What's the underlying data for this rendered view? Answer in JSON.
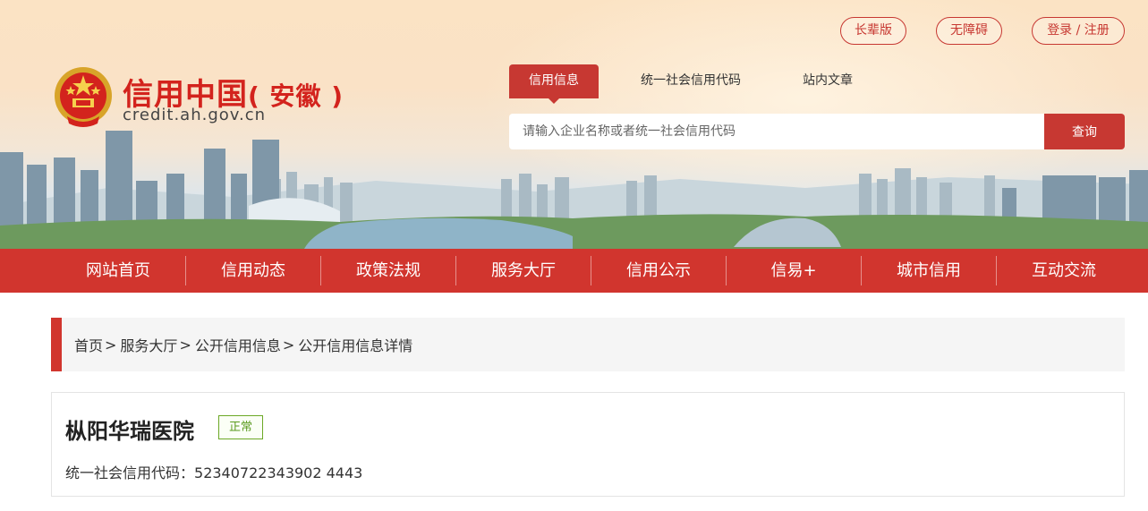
{
  "top_links": {
    "elder": "长辈版",
    "accessible": "无障碍",
    "login": "登录 / 注册"
  },
  "brand": {
    "title_main": "信用中国",
    "title_region": "( 安徽 )",
    "domain": "credit.ah.gov.cn"
  },
  "search": {
    "tabs": [
      "信用信息",
      "统一社会信用代码",
      "站内文章"
    ],
    "active_tab": 0,
    "placeholder": "请输入企业名称或者统一社会信用代码",
    "value": "",
    "button": "查询"
  },
  "nav": {
    "items": [
      "网站首页",
      "信用动态",
      "政策法规",
      "服务大厅",
      "信用公示",
      "信易+",
      "城市信用",
      "互动交流"
    ]
  },
  "breadcrumb": {
    "items": [
      "首页",
      "服务大厅",
      "公开信用信息",
      "公开信用信息详情"
    ],
    "separator": ">"
  },
  "detail": {
    "org_name": "枞阳华瑞医院",
    "status": "正常",
    "code_label": "统一社会信用代码：",
    "code_value": "52340722343902 4443"
  },
  "colors": {
    "brand_red": "#d1352e",
    "accent_red": "#c73832",
    "status_green": "#6ca826"
  },
  "icons": {
    "logo": "national-emblem-icon"
  }
}
